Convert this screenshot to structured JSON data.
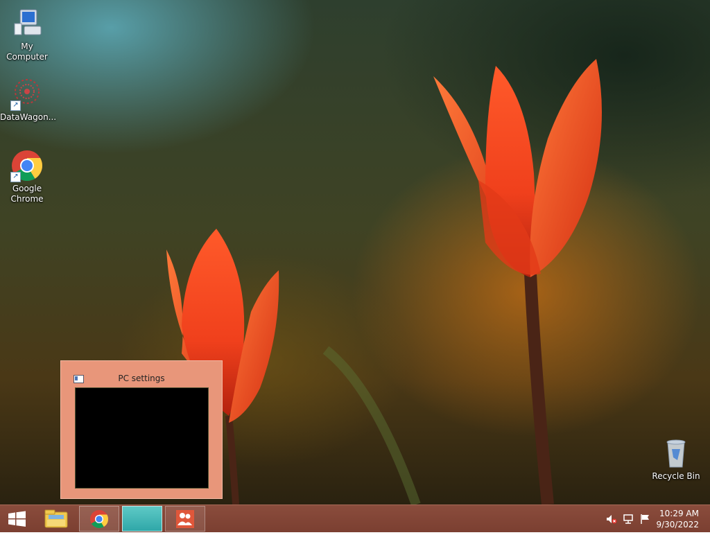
{
  "desktop": {
    "icons": [
      {
        "label": "My Computer",
        "icon": "computer-icon"
      },
      {
        "label": "DataWagon...",
        "icon": "datawagon-icon"
      },
      {
        "label": "Google\nChrome",
        "icon": "chrome-icon"
      },
      {
        "label": "Recycle Bin",
        "icon": "recycle-bin-icon"
      }
    ]
  },
  "preview": {
    "title": "PC settings",
    "icon": "pc-settings-icon"
  },
  "taskbar": {
    "items": [
      "start-icon",
      "file-explorer-icon",
      "chrome-icon",
      "pc-settings-icon",
      "homegroup-icon"
    ],
    "tray": [
      "volume-muted-icon",
      "network-icon",
      "action-center-flag-icon"
    ],
    "time": "10:29 AM",
    "date": "9/30/2022"
  },
  "colors": {
    "taskbar": "#7b3f31",
    "preview_frame": "#e8967a",
    "active_task": "#2fa7a8"
  }
}
